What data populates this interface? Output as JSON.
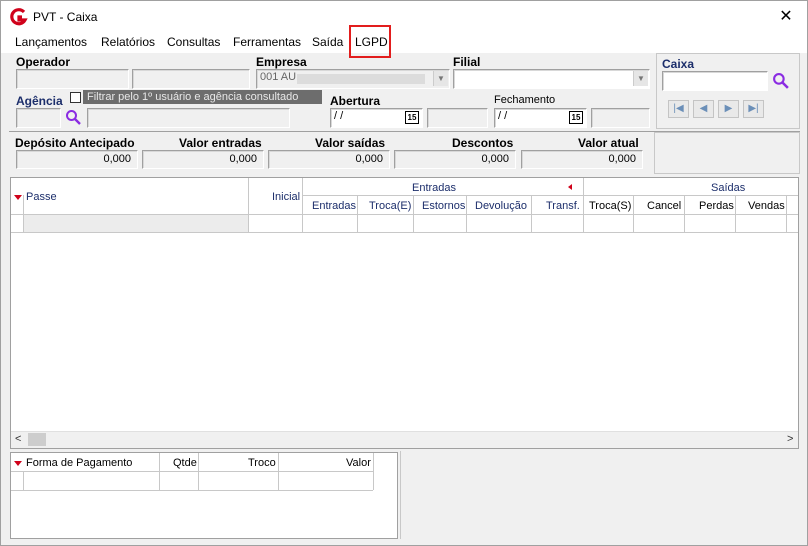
{
  "window": {
    "title": "PVT - Caixa"
  },
  "menu": [
    "Lançamentos",
    "Relatórios",
    "Consultas",
    "Ferramentas",
    "Saída",
    "LGPD"
  ],
  "filters": {
    "operador_label": "Operador",
    "empresa_label": "Empresa",
    "empresa_value": "001 AU",
    "filial_label": "Filial",
    "agencia_label": "Agência",
    "filtrar_label": "Filtrar pelo 1º usuário e agência consultado",
    "abertura_label": "Abertura",
    "abertura_value": " / /",
    "fechamento_label": "Fechamento",
    "fechamento_value": " / /",
    "calendar_day": "15",
    "caixa_label": "Caixa"
  },
  "totals": [
    {
      "label": "Depósito Antecipado",
      "value": "0,000"
    },
    {
      "label": "Valor entradas",
      "value": "0,000"
    },
    {
      "label": "Valor saídas",
      "value": "0,000"
    },
    {
      "label": "Descontos",
      "value": "0,000"
    },
    {
      "label": "Valor atual",
      "value": "0,000"
    }
  ],
  "grid": {
    "col_passe": "Passe",
    "col_inicial": "Inicial",
    "group_entradas": "Entradas",
    "group_saidas": "Saídas",
    "entradas_cols": [
      "Entradas",
      "Troca(E)",
      "Estornos",
      "Devolução",
      "Transf."
    ],
    "saidas_cols": [
      "Troca(S)",
      "Cancel",
      "Perdas",
      "Vendas"
    ]
  },
  "payment_grid": {
    "columns": [
      "Forma de Pagamento",
      "Qtde",
      "Troco",
      "Valor"
    ]
  },
  "colors": {
    "accent_red": "#e21d1d",
    "marker_red": "#d0021b",
    "search_purple": "#8a2be2",
    "label_navy": "#1c2e6b"
  }
}
